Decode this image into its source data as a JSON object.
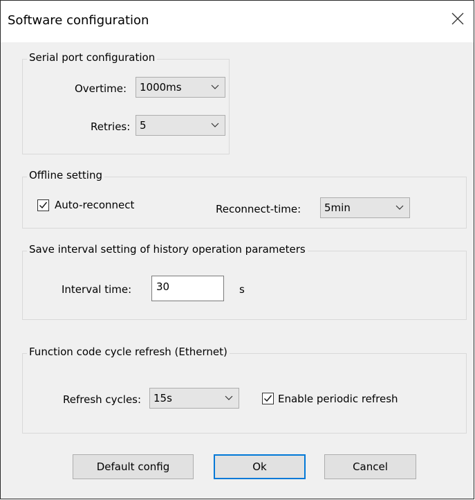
{
  "window": {
    "title": "Software configuration"
  },
  "serial": {
    "legend": "Serial port configuration",
    "overtime_label": "Overtime:",
    "overtime_value": "1000ms",
    "retries_label": "Retries:",
    "retries_value": "5"
  },
  "offline": {
    "legend": "Offline setting",
    "auto_reconnect_label": "Auto-reconnect",
    "auto_reconnect_checked": true,
    "reconnect_time_label": "Reconnect-time:",
    "reconnect_time_value": "5min"
  },
  "save_interval": {
    "legend": "Save interval setting of history operation parameters",
    "interval_label": "Interval time:",
    "interval_value": "30",
    "unit": "s"
  },
  "function_refresh": {
    "legend": "Function code cycle refresh (Ethernet)",
    "refresh_label": "Refresh cycles:",
    "refresh_value": "15s",
    "enable_label": "Enable periodic refresh",
    "enable_checked": true
  },
  "buttons": {
    "default": "Default config",
    "ok": "Ok",
    "cancel": "Cancel"
  }
}
